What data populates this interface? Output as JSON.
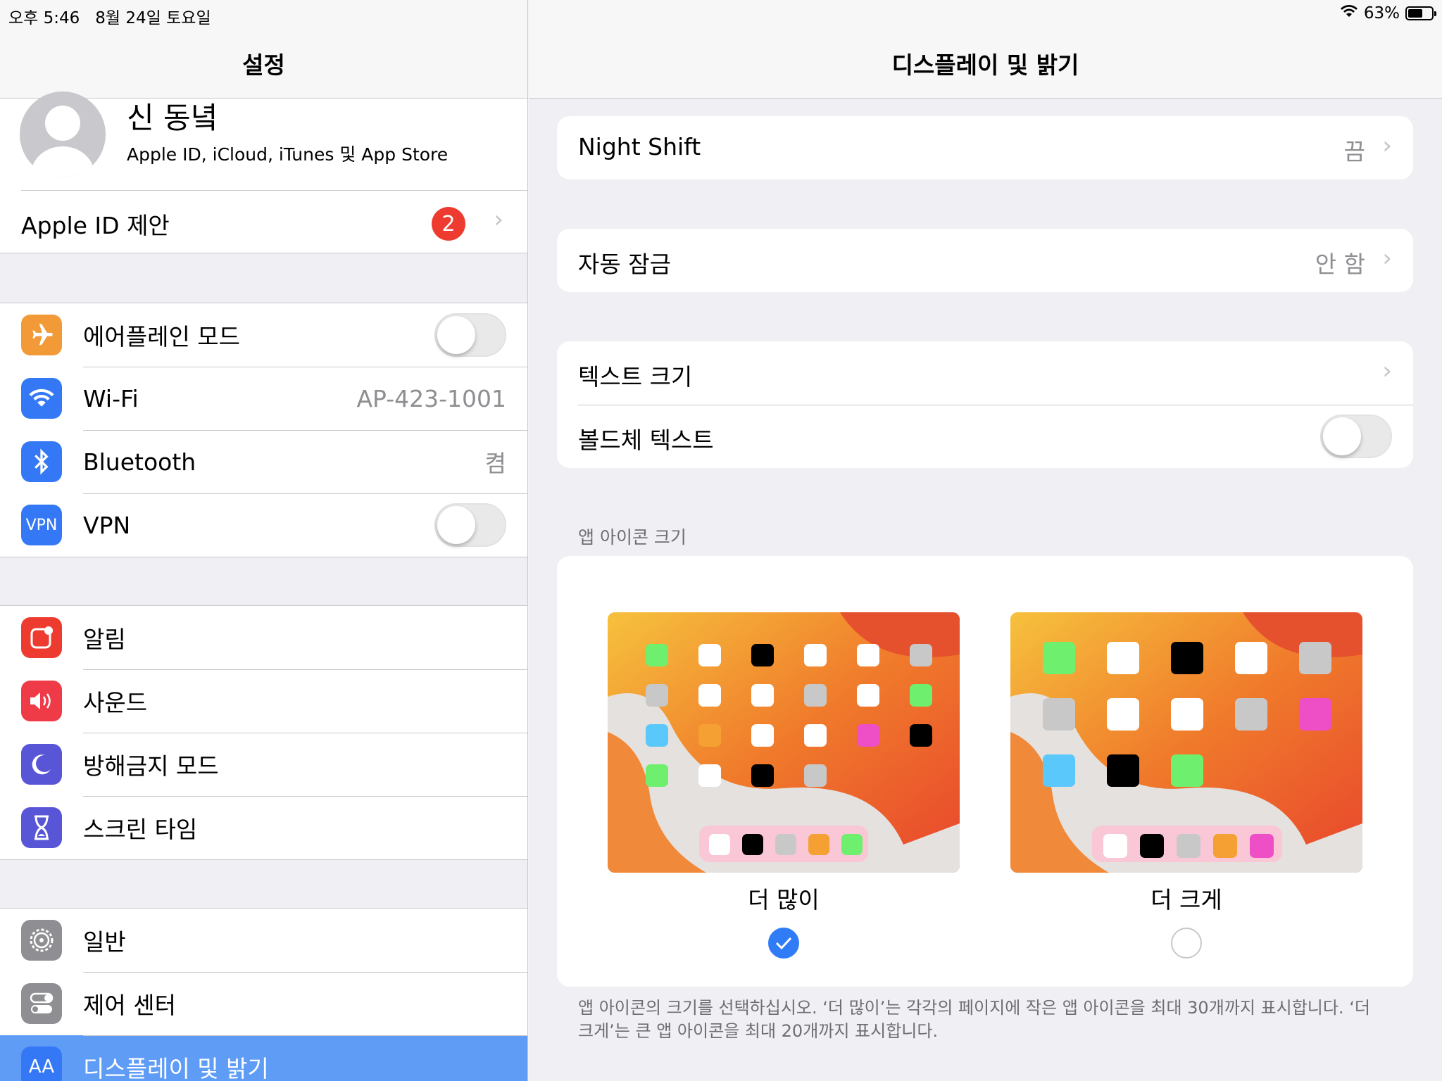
{
  "status_bar": {
    "time": "오후 5:46",
    "date": "8월 24일 토요일",
    "battery_text": "63%",
    "battery_level": 0.63
  },
  "sidebar": {
    "title": "설정",
    "profile": {
      "name": "신 동녘",
      "subtitle": "Apple ID, iCloud, iTunes 및 App Store"
    },
    "apple_id_suggestion": {
      "label": "Apple ID 제안",
      "badge": "2"
    },
    "group1": [
      {
        "label": "에어플레인 모드",
        "icon": "airplane-icon",
        "color": "#f19a37",
        "toggle": false
      },
      {
        "label": "Wi-Fi",
        "icon": "wifi-icon",
        "color": "#3478f6",
        "value": "AP-423-1001"
      },
      {
        "label": "Bluetooth",
        "icon": "bluetooth-icon",
        "color": "#3478f6",
        "value": "켬"
      },
      {
        "label": "VPN",
        "icon": "vpn-icon",
        "icon_text": "VPN",
        "color": "#3478f6",
        "toggle": false
      }
    ],
    "group2": [
      {
        "label": "알림",
        "icon": "notifications-icon",
        "color": "#ee3b30"
      },
      {
        "label": "사운드",
        "icon": "sound-icon",
        "color": "#ee3b47"
      },
      {
        "label": "방해금지 모드",
        "icon": "moon-icon",
        "color": "#5856d6"
      },
      {
        "label": "스크린 타임",
        "icon": "hourglass-icon",
        "color": "#5856d6"
      }
    ],
    "group3": [
      {
        "label": "일반",
        "icon": "gear-icon",
        "color": "#8e8e93"
      },
      {
        "label": "제어 센터",
        "icon": "switches-icon",
        "color": "#8e8e93"
      },
      {
        "label": "디스플레이 및 밝기",
        "icon": "display-icon",
        "icon_text": "AA",
        "color": "#3478f6",
        "selected": true
      }
    ]
  },
  "detail": {
    "title": "디스플레이 및 밝기",
    "night_shift": {
      "label": "Night Shift",
      "value": "끔"
    },
    "auto_lock": {
      "label": "자동 잠금",
      "value": "안 함"
    },
    "text_size": {
      "label": "텍스트 크기"
    },
    "bold_text": {
      "label": "볼드체 텍스트",
      "toggle": false
    },
    "app_icon_section": {
      "header": "앱 아이콘 크기",
      "options": [
        {
          "label": "더 많이",
          "selected": true
        },
        {
          "label": "더 크게",
          "selected": false
        }
      ]
    },
    "footnote": "앱 아이콘의 크기를 선택하십시오. ‘더 많이’는 각각의 페이지에 작은 앱 아이콘을 최대 30개까지 표시합니다. ‘더 크게’는 큰 앱 아이콘을 최대 20개까지 표시합니다."
  }
}
